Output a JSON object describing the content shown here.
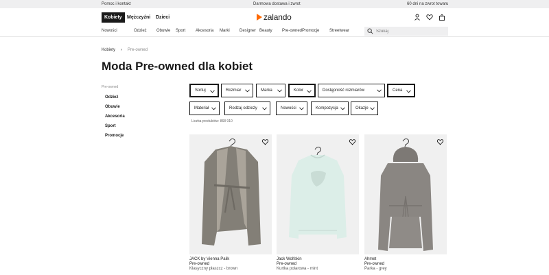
{
  "topbar": {
    "left": "Pomoc i kontakt",
    "center": "Darmowa dostawa i zwrot",
    "right": "60 dni na zwrot towaru"
  },
  "header": {
    "gender_tabs": [
      {
        "label": "Kobiety",
        "active": true
      },
      {
        "label": "Mężczyźni",
        "active": false
      },
      {
        "label": "Dzieci",
        "active": false
      }
    ],
    "logo": "zalando",
    "brand_color": "#ff6900"
  },
  "nav": {
    "items": [
      "Nowości",
      "Odzież",
      "Obuwie",
      "Sport",
      "Akcesoria",
      "Marki",
      "Designer",
      "Beauty",
      "Pre-owned",
      "Promocje",
      "Streetwear"
    ],
    "search_placeholder": "Szukaj"
  },
  "breadcrumb": {
    "root": "Kobiety",
    "current": "Pre-owned"
  },
  "page_title": "Moda Pre-owned dla kobiet",
  "sidebar": {
    "title": "Pre-owned",
    "items": [
      "Odzież",
      "Obuwie",
      "Akcesoria",
      "Sport",
      "Promocje"
    ]
  },
  "filters": {
    "row1": [
      "Sortuj",
      "Rozmiar",
      "Marka",
      "Kolor",
      "Dostępność rozmiarów",
      "Cena"
    ],
    "row2": [
      "Materiał",
      "Rodzaj odzieży",
      "Nowości",
      "Kompozycja",
      "Okazje"
    ]
  },
  "product_count": "Liczba produktów: 868 910",
  "products": [
    {
      "brand": "JACK by Vienna Palik",
      "condition": "Pre-owned",
      "desc": "Klasyczny płaszcz - brown"
    },
    {
      "brand": "Jack Wolfskin",
      "condition": "Pre-owned",
      "desc": "Kurtka polarowa - mint"
    },
    {
      "brand": "Ahmet",
      "condition": "Pre-owned",
      "desc": "Parka - grey"
    }
  ],
  "colors": {
    "coat1_body": "#837f77",
    "coat1_lapel": "#aaa49a",
    "coat2_body": "#dceee8",
    "coat3_body": "#8a8682"
  }
}
